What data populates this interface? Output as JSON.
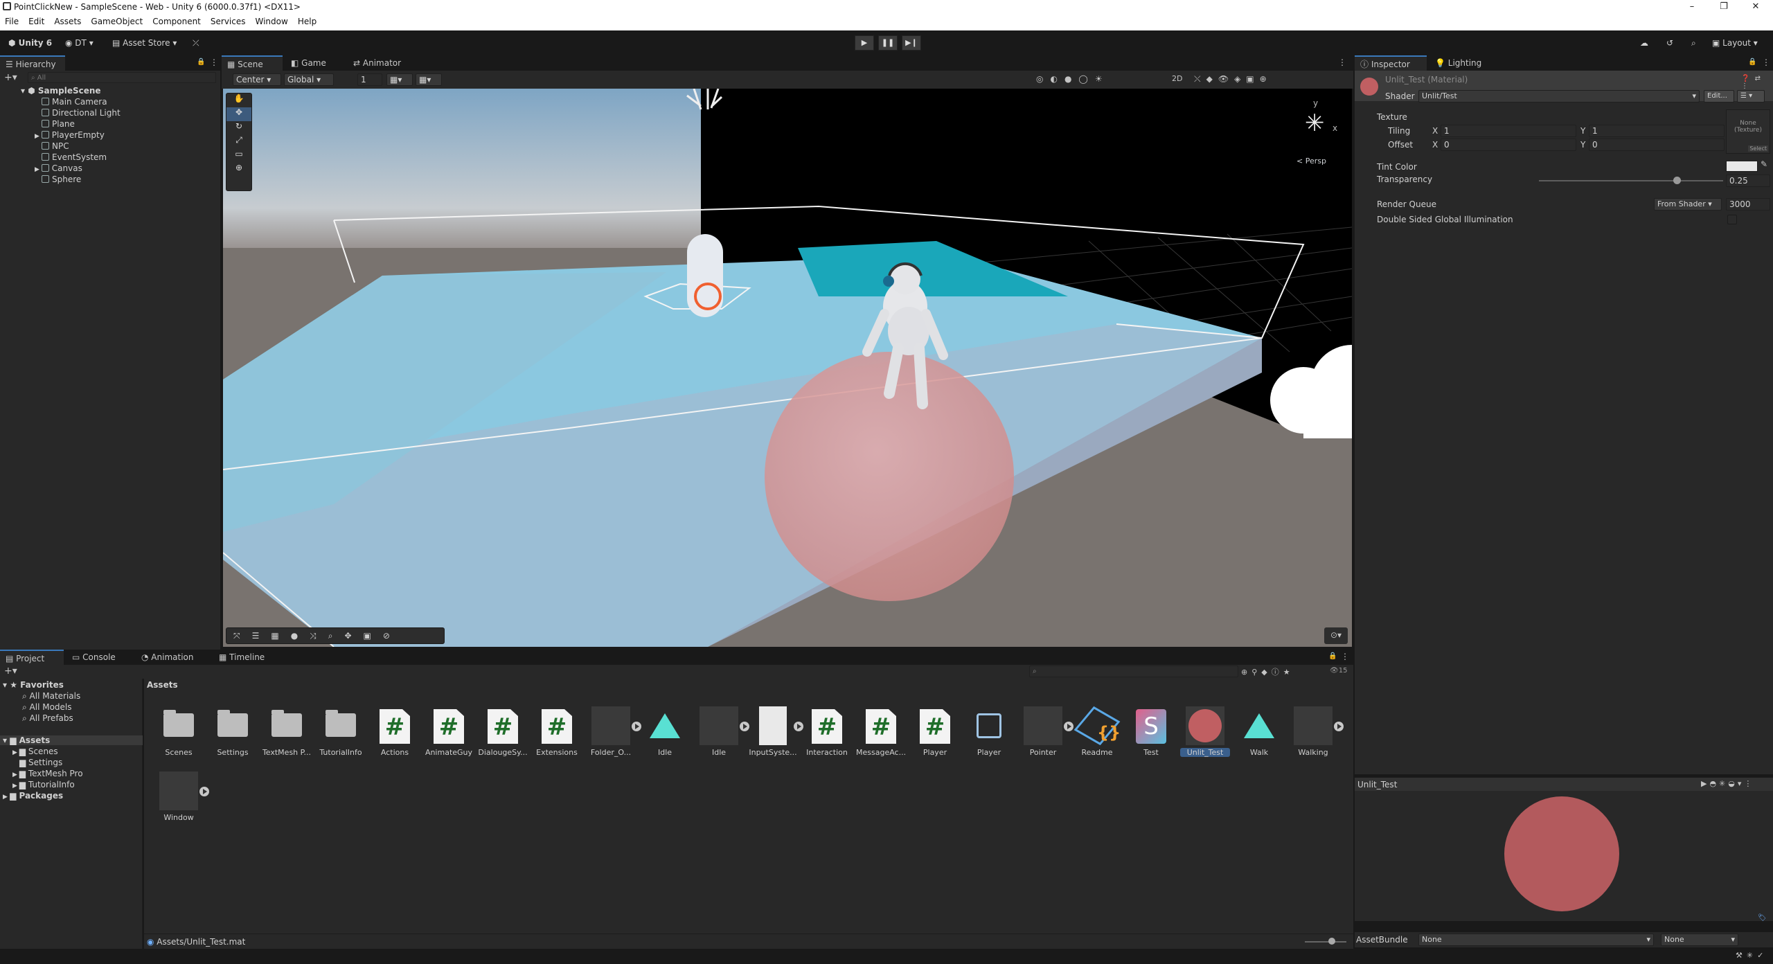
{
  "window": {
    "title": "PointClickNew - SampleScene - Web - Unity 6 (6000.0.37f1) <DX11>"
  },
  "menu": [
    "File",
    "Edit",
    "Assets",
    "GameObject",
    "Component",
    "Services",
    "Window",
    "Help"
  ],
  "toolbar": {
    "account": "Unity 6",
    "user": "DT",
    "asset_store": "Asset Store",
    "layout": "Layout"
  },
  "hierarchy": {
    "tab": "Hierarchy",
    "search_placeholder": "All",
    "scene": "SampleScene",
    "items": [
      "Main Camera",
      "Directional Light",
      "Plane",
      "PlayerEmpty",
      "NPC",
      "EventSystem",
      "Canvas",
      "Sphere"
    ]
  },
  "scene_view": {
    "tabs": [
      "Scene",
      "Game",
      "Animator"
    ],
    "pivot": "Center",
    "space": "Global",
    "snap_value": "1",
    "mode_2d": "2D",
    "gizmo_label": "< Persp",
    "axis_y": "y",
    "axis_x": "x"
  },
  "inspector": {
    "tabs": [
      "Inspector",
      "Lighting"
    ],
    "title": "Unlit_Test (Material)",
    "shader_label": "Shader",
    "shader_value": "Unlit/Test",
    "edit_label": "Edit...",
    "texture_label": "Texture",
    "texture_slot": "None\n(Texture)",
    "select_label": "Select",
    "tiling_label": "Tiling",
    "offset_label": "Offset",
    "tiling_x": "1",
    "tiling_y": "1",
    "offset_x": "0",
    "offset_y": "0",
    "x": "X",
    "y": "Y",
    "tint_label": "Tint Color",
    "transparency_label": "Transparency",
    "transparency_value": "0.25",
    "transparency": 0.25,
    "render_queue_label": "Render Queue",
    "render_queue_mode": "From Shader",
    "render_queue_value": "3000",
    "dsgi_label": "Double Sided Global Illumination",
    "preview_title": "Unlit_Test",
    "assetbundle_label": "AssetBundle",
    "assetbundle_value": "None",
    "assetbundle_variant": "None",
    "colors": {
      "material": "#c05f62",
      "preview": "#b35a5d"
    }
  },
  "project": {
    "tabs": [
      "Project",
      "Console",
      "Animation",
      "Timeline"
    ],
    "favorites_label": "Favorites",
    "favorites": [
      "All Materials",
      "All Models",
      "All Prefabs"
    ],
    "assets_label": "Assets",
    "asset_folders": [
      "Scenes",
      "Settings",
      "TextMesh Pro",
      "TutorialInfo"
    ],
    "packages_label": "Packages",
    "breadcrumb": "Assets",
    "count": "15",
    "items": [
      {
        "name": "Scenes",
        "kind": "folder"
      },
      {
        "name": "Settings",
        "kind": "folder"
      },
      {
        "name": "TextMesh P...",
        "kind": "folder"
      },
      {
        "name": "TutorialInfo",
        "kind": "folder"
      },
      {
        "name": "Actions",
        "kind": "script"
      },
      {
        "name": "AnimateGuy",
        "kind": "script"
      },
      {
        "name": "DialougeSy...",
        "kind": "script"
      },
      {
        "name": "Extensions",
        "kind": "script"
      },
      {
        "name": "Folder_O...",
        "kind": "model"
      },
      {
        "name": "Idle",
        "kind": "anim"
      },
      {
        "name": "Idle",
        "kind": "model"
      },
      {
        "name": "InputSyste...",
        "kind": "input"
      },
      {
        "name": "Interaction",
        "kind": "script"
      },
      {
        "name": "MessageAc...",
        "kind": "script"
      },
      {
        "name": "Player",
        "kind": "script"
      },
      {
        "name": "Player",
        "kind": "prefab"
      },
      {
        "name": "Pointer",
        "kind": "model"
      },
      {
        "name": "Readme",
        "kind": "readme"
      },
      {
        "name": "Test",
        "kind": "shader"
      },
      {
        "name": "Unlit_Test",
        "kind": "material"
      },
      {
        "name": "Walk",
        "kind": "anim"
      },
      {
        "name": "Walking",
        "kind": "model"
      },
      {
        "name": "Window",
        "kind": "model"
      }
    ],
    "status_path": "Assets/Unlit_Test.mat"
  }
}
